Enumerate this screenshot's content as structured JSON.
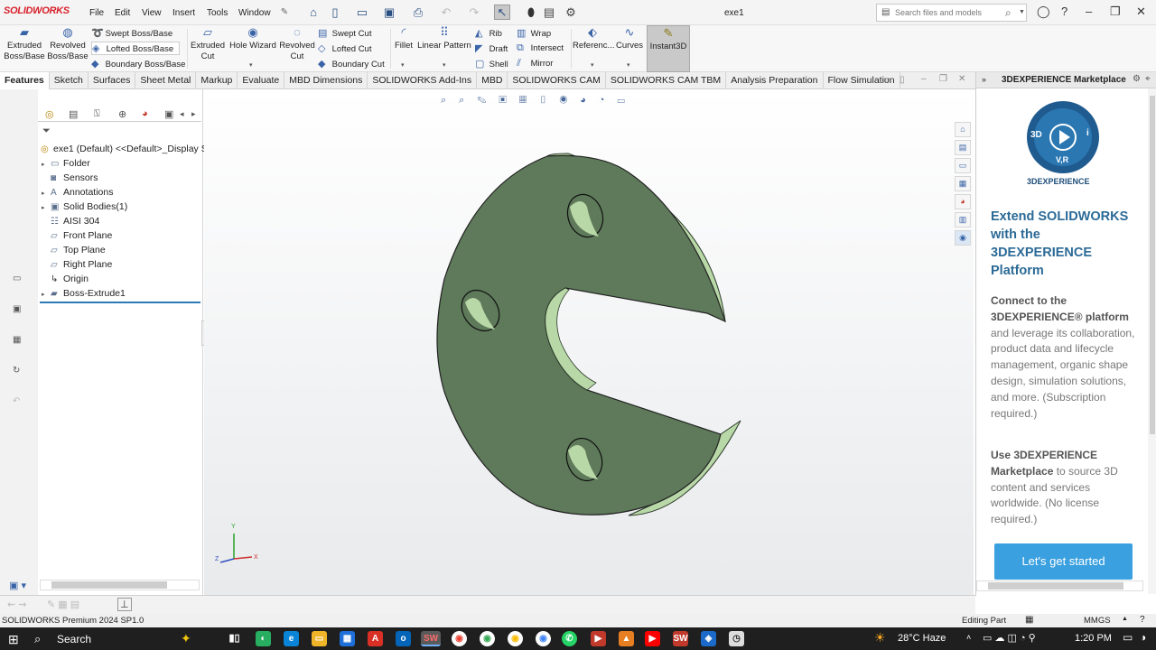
{
  "app": {
    "logo": "SOLIDWORKS",
    "document_title": "exe1"
  },
  "menu": [
    "File",
    "Edit",
    "View",
    "Insert",
    "Tools",
    "Window"
  ],
  "search": {
    "placeholder": "Search files and models"
  },
  "commands": {
    "extruded_boss": "Extruded Boss/Base",
    "revolved_boss": "Revolved Boss/Base",
    "swept_boss": "Swept Boss/Base",
    "lofted_boss": "Lofted Boss/Base",
    "boundary_boss": "Boundary Boss/Base",
    "extruded_cut": "Extruded Cut",
    "hole_wizard": "Hole Wizard",
    "revolved_cut": "Revolved Cut",
    "swept_cut": "Swept Cut",
    "lofted_cut": "Lofted Cut",
    "boundary_cut": "Boundary Cut",
    "fillet": "Fillet",
    "linear_pattern": "Linear Pattern",
    "rib": "Rib",
    "draft": "Draft",
    "shell": "Shell",
    "wrap": "Wrap",
    "intersect": "Intersect",
    "mirror": "Mirror",
    "reference": "Referenc...",
    "curves": "Curves",
    "instant3d": "Instant3D"
  },
  "tabs": [
    "Features",
    "Sketch",
    "Surfaces",
    "Sheet Metal",
    "Markup",
    "Evaluate",
    "MBD Dimensions",
    "SOLIDWORKS Add-Ins",
    "MBD",
    "SOLIDWORKS CAM",
    "SOLIDWORKS CAM TBM",
    "Analysis Preparation",
    "Flow Simulation"
  ],
  "tree": {
    "root": "exe1 (Default) <<Default>_Display S",
    "items": [
      {
        "label": "Folder",
        "expandable": true
      },
      {
        "label": "Sensors",
        "expandable": false
      },
      {
        "label": "Annotations",
        "expandable": true
      },
      {
        "label": "Solid Bodies(1)",
        "expandable": true
      },
      {
        "label": "AISI 304",
        "expandable": false
      },
      {
        "label": "Front Plane",
        "expandable": false
      },
      {
        "label": "Top Plane",
        "expandable": false
      },
      {
        "label": "Right Plane",
        "expandable": false
      },
      {
        "label": "Origin",
        "expandable": false
      },
      {
        "label": "Boss-Extrude1",
        "expandable": true
      }
    ]
  },
  "triad": {
    "x": "X",
    "y": "Y",
    "z": "Z"
  },
  "marketplace": {
    "header": "3DEXPERIENCE Marketplace",
    "brand": "3DEXPERIENCE",
    "logo_letters": {
      "left": "3D",
      "right": "i",
      "bottom": "V,R"
    },
    "headline": "Extend SOLIDWORKS with the 3DEXPERIENCE Platform",
    "para1_bold": "Connect to the 3DEXPERIENCE® platform",
    "para1_rest": "and leverage its collaboration, product data and lifecycle management, organic shape design, simulation solutions, and more. (Subscription required.)",
    "para2_bold": "Use 3DEXPERIENCE Marketplace",
    "para2_rest": "to source 3D content and services worldwide. (No license required.)",
    "cta": "Let's get started"
  },
  "status": {
    "left": "SOLIDWORKS Premium 2024 SP1.0",
    "mode": "Editing Part",
    "units": "MMGS"
  },
  "taskbar": {
    "search": "Search",
    "weather": "28°C Haze",
    "time": "1:20 PM"
  }
}
